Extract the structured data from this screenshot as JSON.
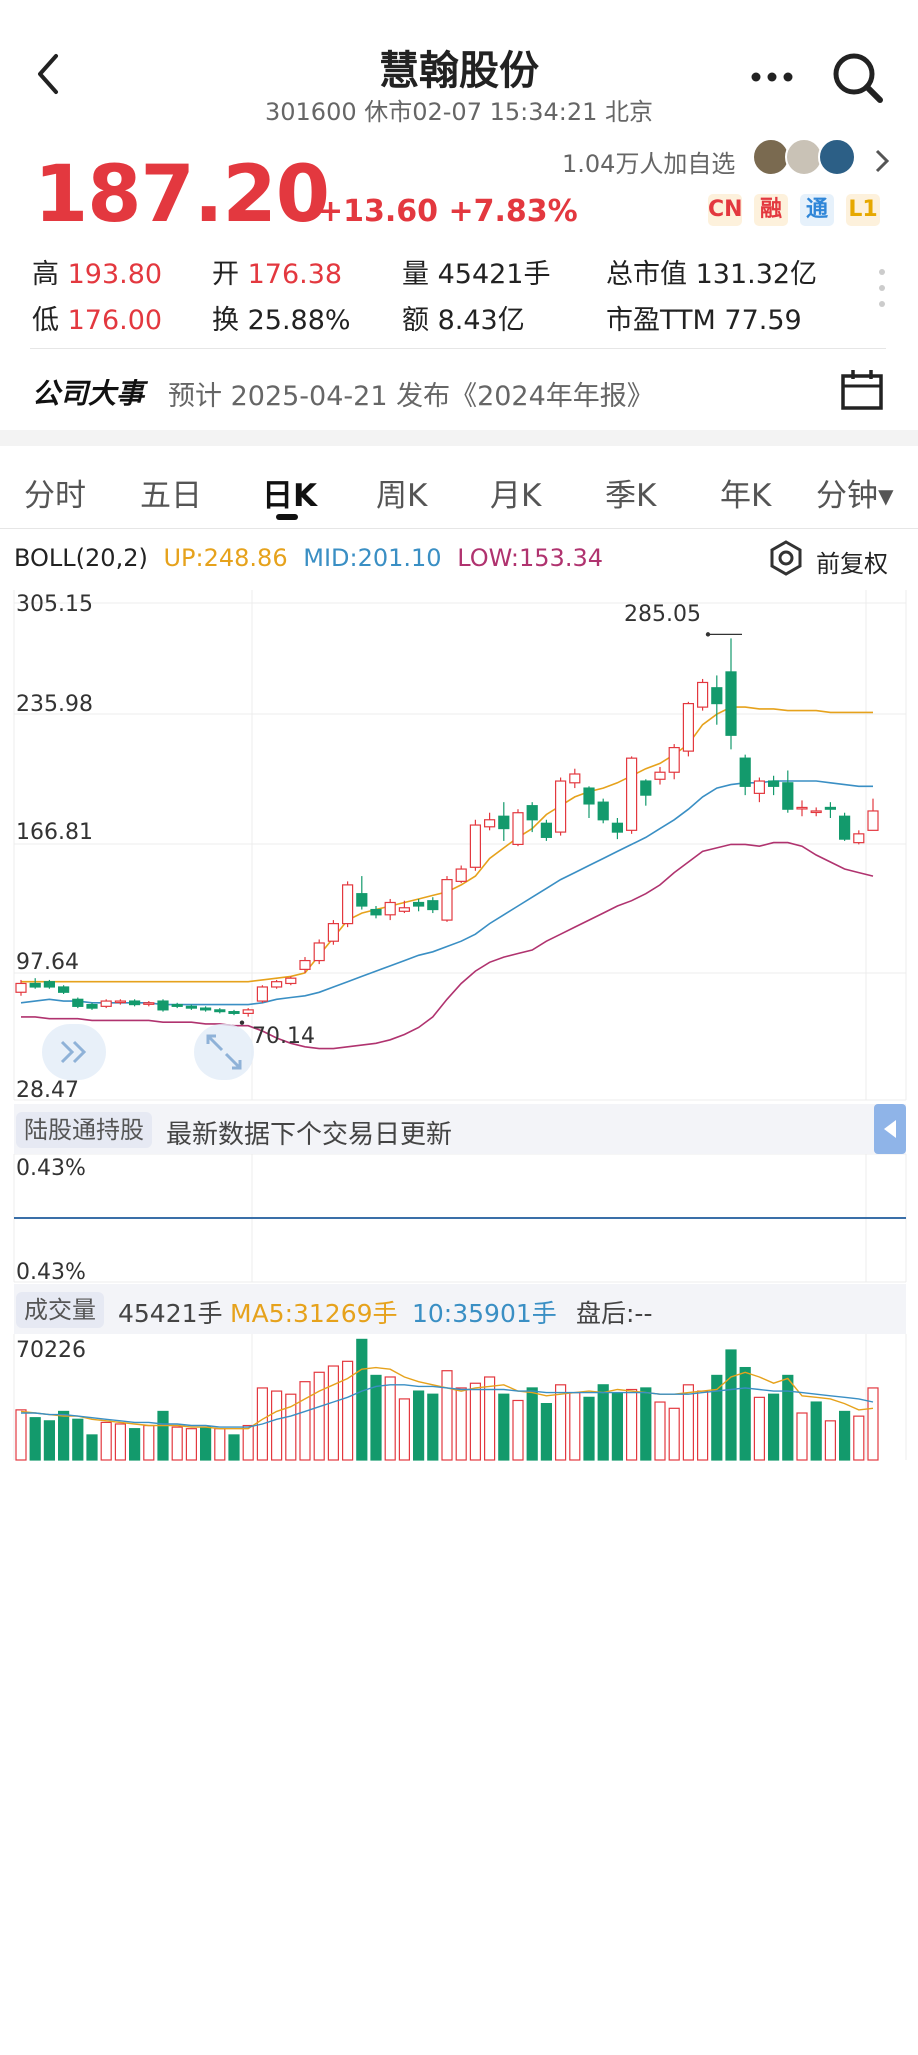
{
  "header": {
    "title": "慧翰股份",
    "subtitle": "301600 休市02-07 15:34:21 北京"
  },
  "quote": {
    "price": "187.20",
    "change": "+13.60 +7.83%",
    "followers": "1.04万人加自选",
    "badges": [
      {
        "label": "CN",
        "color": "#e3383f"
      },
      {
        "label": "融",
        "color": "#e3383f"
      },
      {
        "label": "通",
        "color": "#2f86d8"
      },
      {
        "label": "L1",
        "color": "#e6a800"
      }
    ]
  },
  "stats": {
    "high_label": "高",
    "high": "193.80",
    "low_label": "低",
    "low": "176.00",
    "open_label": "开",
    "open": "176.38",
    "turnover_label": "换",
    "turnover": "25.88%",
    "volume": "量 45421手",
    "amount": "额 8.43亿",
    "market_cap": "总市值 131.32亿",
    "pe": "市盈TTM 77.59"
  },
  "event": {
    "title": "公司大事",
    "text": "预计 2025-04-21 发布《2024年年报》"
  },
  "tabs": [
    {
      "label": "分时"
    },
    {
      "label": "五日"
    },
    {
      "label": "日K"
    },
    {
      "label": "周K"
    },
    {
      "label": "月K"
    },
    {
      "label": "季K"
    },
    {
      "label": "年K"
    },
    {
      "label": "分钟▾"
    }
  ],
  "colors": {
    "up": "#e3383f",
    "down": "#139a6c",
    "boll_up": "#e6a21c",
    "boll_mid": "#3a8fc4",
    "boll_low": "#b0336f"
  },
  "boll": {
    "name": "BOLL(20,2)",
    "up": "UP:248.86",
    "mid": "MID:201.10",
    "low": "LOW:153.34",
    "adjust": "前复权"
  },
  "hk_hold": {
    "label": "陆股通持股",
    "text": "最新数据下个交易日更新",
    "ticks": [
      "0.43%",
      "0.43%"
    ]
  },
  "volume_section": {
    "label": "成交量",
    "value": "45421手",
    "ma5": "MA5:31269手",
    "ma10": "10:35901手",
    "after_hours": "盘后:--",
    "max_label": "70226"
  },
  "chart_data": {
    "type": "candlestick",
    "y_ticks": [
      "305.15",
      "235.98",
      "166.81",
      "97.64",
      "28.47"
    ],
    "ylim": [
      28.47,
      305.15
    ],
    "annotations": [
      {
        "text": "285.05",
        "type": "max"
      },
      {
        "text": "70.14",
        "type": "min"
      }
    ],
    "candles": [
      {
        "o": 84,
        "c": 89,
        "h": 91,
        "l": 82
      },
      {
        "o": 89,
        "c": 87,
        "h": 92,
        "l": 86
      },
      {
        "o": 90,
        "c": 87,
        "h": 91,
        "l": 86
      },
      {
        "o": 87,
        "c": 84,
        "h": 88,
        "l": 83
      },
      {
        "o": 80,
        "c": 76,
        "h": 81,
        "l": 75
      },
      {
        "o": 77,
        "c": 75,
        "h": 78,
        "l": 74
      },
      {
        "o": 76,
        "c": 79,
        "h": 80,
        "l": 75
      },
      {
        "o": 79,
        "c": 79,
        "h": 80,
        "l": 77
      },
      {
        "o": 79,
        "c": 77,
        "h": 80,
        "l": 76
      },
      {
        "o": 78,
        "c": 78,
        "h": 79,
        "l": 76
      },
      {
        "o": 79,
        "c": 74,
        "h": 80,
        "l": 73
      },
      {
        "o": 77,
        "c": 76,
        "h": 78,
        "l": 75
      },
      {
        "o": 76,
        "c": 75,
        "h": 77,
        "l": 74
      },
      {
        "o": 75,
        "c": 74,
        "h": 76,
        "l": 73
      },
      {
        "o": 74,
        "c": 73,
        "h": 75,
        "l": 72
      },
      {
        "o": 73,
        "c": 72,
        "h": 74,
        "l": 71
      },
      {
        "o": 72,
        "c": 74,
        "h": 75,
        "l": 70.14
      },
      {
        "o": 79,
        "c": 87,
        "h": 88,
        "l": 78
      },
      {
        "o": 87,
        "c": 90,
        "h": 91,
        "l": 86
      },
      {
        "o": 89,
        "c": 92,
        "h": 93,
        "l": 88
      },
      {
        "o": 97,
        "c": 102,
        "h": 104,
        "l": 95
      },
      {
        "o": 102,
        "c": 112,
        "h": 114,
        "l": 100
      },
      {
        "o": 113,
        "c": 123,
        "h": 125,
        "l": 111
      },
      {
        "o": 123,
        "c": 145,
        "h": 147,
        "l": 121
      },
      {
        "o": 140,
        "c": 133,
        "h": 150,
        "l": 131
      },
      {
        "o": 131,
        "c": 128,
        "h": 133,
        "l": 126
      },
      {
        "o": 128,
        "c": 135,
        "h": 137,
        "l": 125
      },
      {
        "o": 130,
        "c": 132,
        "h": 136,
        "l": 129
      },
      {
        "o": 135,
        "c": 133,
        "h": 137,
        "l": 130
      },
      {
        "o": 136,
        "c": 131,
        "h": 138,
        "l": 129
      },
      {
        "o": 125,
        "c": 148,
        "h": 150,
        "l": 124
      },
      {
        "o": 147,
        "c": 154,
        "h": 156,
        "l": 146
      },
      {
        "o": 155,
        "c": 179,
        "h": 182,
        "l": 153
      },
      {
        "o": 178,
        "c": 182,
        "h": 186,
        "l": 176
      },
      {
        "o": 184,
        "c": 177,
        "h": 192,
        "l": 170
      },
      {
        "o": 168,
        "c": 186,
        "h": 188,
        "l": 167
      },
      {
        "o": 190,
        "c": 182,
        "h": 192,
        "l": 175
      },
      {
        "o": 180,
        "c": 172,
        "h": 182,
        "l": 170
      },
      {
        "o": 175,
        "c": 204,
        "h": 206,
        "l": 173
      },
      {
        "o": 203,
        "c": 208,
        "h": 211,
        "l": 200
      },
      {
        "o": 200,
        "c": 191,
        "h": 201,
        "l": 183
      },
      {
        "o": 192,
        "c": 182,
        "h": 194,
        "l": 180
      },
      {
        "o": 180,
        "c": 175,
        "h": 183,
        "l": 171
      },
      {
        "o": 176,
        "c": 217,
        "h": 218,
        "l": 174
      },
      {
        "o": 204,
        "c": 196,
        "h": 205,
        "l": 190
      },
      {
        "o": 205,
        "c": 209,
        "h": 212,
        "l": 202
      },
      {
        "o": 209,
        "c": 223,
        "h": 225,
        "l": 205
      },
      {
        "o": 221,
        "c": 248,
        "h": 249,
        "l": 218
      },
      {
        "o": 246,
        "c": 260,
        "h": 262,
        "l": 244
      },
      {
        "o": 257,
        "c": 248,
        "h": 264,
        "l": 236
      },
      {
        "o": 266,
        "c": 230,
        "h": 285.05,
        "l": 222
      },
      {
        "o": 217,
        "c": 201,
        "h": 219,
        "l": 196
      },
      {
        "o": 197,
        "c": 204,
        "h": 206,
        "l": 192
      },
      {
        "o": 204,
        "c": 201,
        "h": 207,
        "l": 196
      },
      {
        "o": 203,
        "c": 188,
        "h": 210,
        "l": 186
      },
      {
        "o": 189,
        "c": 189,
        "h": 193,
        "l": 184
      },
      {
        "o": 187,
        "c": 187,
        "h": 189,
        "l": 184
      },
      {
        "o": 189,
        "c": 188,
        "h": 192,
        "l": 183
      },
      {
        "o": 184,
        "c": 171,
        "h": 186,
        "l": 170
      },
      {
        "o": 169,
        "c": 174,
        "h": 176,
        "l": 168
      },
      {
        "o": 176,
        "c": 187,
        "h": 194,
        "l": 176
      }
    ],
    "boll_up": [
      90,
      90,
      90,
      90,
      90,
      90,
      90,
      90,
      90,
      90,
      90,
      90,
      90,
      90,
      90,
      90,
      90,
      91,
      92,
      93,
      95,
      105,
      115,
      125,
      129,
      131,
      133,
      135,
      137,
      139,
      141,
      145,
      150,
      160,
      166,
      172,
      177,
      185,
      190,
      195,
      198,
      200,
      203,
      207,
      211,
      214,
      219,
      225,
      236,
      242,
      246,
      246,
      245,
      245,
      244,
      244,
      244,
      243,
      243,
      243,
      243
    ],
    "boll_mid": [
      78,
      79,
      80,
      79,
      79,
      78,
      78,
      78,
      78,
      78,
      77,
      77,
      77,
      77,
      77,
      77,
      77,
      78,
      80,
      81,
      82,
      84,
      87,
      90,
      93,
      96,
      99,
      102,
      105,
      107,
      110,
      113,
      117,
      123,
      128,
      133,
      138,
      143,
      148,
      152,
      156,
      160,
      164,
      168,
      172,
      177,
      182,
      188,
      195,
      200,
      202,
      203,
      203,
      204,
      204,
      204,
      204,
      203,
      202,
      201,
      201
    ],
    "boll_low": [
      70,
      70,
      69,
      69,
      69,
      68,
      68,
      68,
      68,
      68,
      67,
      67,
      67,
      66,
      66,
      65,
      65,
      62,
      58,
      55,
      53,
      52,
      52,
      53,
      54,
      55,
      57,
      60,
      64,
      70,
      80,
      89,
      96,
      101,
      104,
      106,
      108,
      113,
      117,
      121,
      125,
      129,
      133,
      136,
      140,
      145,
      152,
      158,
      164,
      166,
      168,
      168,
      167,
      169,
      169,
      167,
      162,
      158,
      154,
      152,
      150
    ]
  },
  "volume_data": {
    "max": 70226,
    "bars": [
      {
        "v": 32000,
        "up": true
      },
      {
        "v": 27000,
        "up": false
      },
      {
        "v": 25000,
        "up": false
      },
      {
        "v": 31000,
        "up": false
      },
      {
        "v": 26000,
        "up": false
      },
      {
        "v": 16000,
        "up": false
      },
      {
        "v": 24000,
        "up": true
      },
      {
        "v": 23000,
        "up": true
      },
      {
        "v": 20000,
        "up": false
      },
      {
        "v": 22000,
        "up": true
      },
      {
        "v": 31000,
        "up": false
      },
      {
        "v": 21000,
        "up": true
      },
      {
        "v": 20000,
        "up": true
      },
      {
        "v": 21000,
        "up": false
      },
      {
        "v": 20000,
        "up": true
      },
      {
        "v": 16000,
        "up": false
      },
      {
        "v": 22000,
        "up": true
      },
      {
        "v": 46000,
        "up": true
      },
      {
        "v": 44000,
        "up": true
      },
      {
        "v": 42000,
        "up": true
      },
      {
        "v": 50000,
        "up": true
      },
      {
        "v": 56000,
        "up": true
      },
      {
        "v": 60000,
        "up": true
      },
      {
        "v": 63000,
        "up": true
      },
      {
        "v": 77000,
        "up": false
      },
      {
        "v": 54000,
        "up": false
      },
      {
        "v": 53000,
        "up": true
      },
      {
        "v": 39000,
        "up": true
      },
      {
        "v": 44000,
        "up": false
      },
      {
        "v": 42000,
        "up": false
      },
      {
        "v": 57000,
        "up": true
      },
      {
        "v": 46000,
        "up": true
      },
      {
        "v": 49000,
        "up": true
      },
      {
        "v": 53000,
        "up": true
      },
      {
        "v": 42000,
        "up": false
      },
      {
        "v": 38000,
        "up": true
      },
      {
        "v": 46000,
        "up": false
      },
      {
        "v": 36000,
        "up": false
      },
      {
        "v": 48000,
        "up": true
      },
      {
        "v": 43000,
        "up": true
      },
      {
        "v": 40000,
        "up": false
      },
      {
        "v": 48000,
        "up": false
      },
      {
        "v": 43000,
        "up": false
      },
      {
        "v": 45000,
        "up": true
      },
      {
        "v": 46000,
        "up": false
      },
      {
        "v": 37000,
        "up": true
      },
      {
        "v": 33000,
        "up": true
      },
      {
        "v": 48000,
        "up": true
      },
      {
        "v": 44000,
        "up": true
      },
      {
        "v": 54000,
        "up": false
      },
      {
        "v": 70226,
        "up": false
      },
      {
        "v": 59000,
        "up": false
      },
      {
        "v": 40000,
        "up": true
      },
      {
        "v": 42000,
        "up": false
      },
      {
        "v": 54000,
        "up": false
      },
      {
        "v": 30000,
        "up": true
      },
      {
        "v": 37000,
        "up": false
      },
      {
        "v": 25000,
        "up": true
      },
      {
        "v": 31000,
        "up": false
      },
      {
        "v": 28000,
        "up": true
      },
      {
        "v": 46000,
        "up": true
      }
    ],
    "ma5": [
      31000,
      30000,
      29000,
      28000,
      28000,
      26000,
      25000,
      24000,
      23000,
      22000,
      22000,
      22000,
      21000,
      21000,
      20000,
      20000,
      20000,
      26000,
      31000,
      34000,
      39000,
      44000,
      48000,
      52000,
      58000,
      59000,
      58000,
      53000,
      50000,
      48000,
      46000,
      44000,
      46000,
      47000,
      48000,
      44000,
      43000,
      41000,
      42000,
      43000,
      44000,
      43000,
      45000,
      44000,
      43000,
      42000,
      42000,
      43000,
      44000,
      45000,
      53000,
      56000,
      53000,
      49000,
      52000,
      41000,
      40000,
      39000,
      36000,
      32000,
      33000
    ],
    "ma10": [
      30000,
      30000,
      29000,
      29000,
      28000,
      27000,
      26000,
      25000,
      24000,
      24000,
      23000,
      23000,
      22000,
      22000,
      21000,
      21000,
      21000,
      23000,
      26000,
      28000,
      31000,
      34000,
      37000,
      40000,
      44000,
      47000,
      48000,
      48000,
      47000,
      47000,
      46000,
      45000,
      45000,
      45000,
      45000,
      44000,
      44000,
      43000,
      43000,
      43000,
      43000,
      43000,
      43000,
      43000,
      43000,
      42000,
      42000,
      42000,
      43000,
      44000,
      45000,
      46000,
      45000,
      44000,
      44000,
      43000,
      42000,
      41000,
      40000,
      39000,
      37000
    ]
  }
}
